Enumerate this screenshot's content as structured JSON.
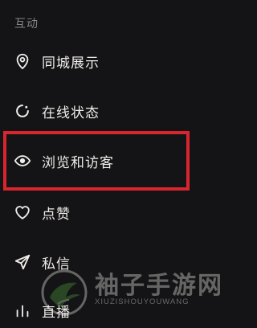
{
  "section": {
    "title": "互动"
  },
  "menu": {
    "items": [
      {
        "label": "同城展示",
        "icon": "location-pin-icon"
      },
      {
        "label": "在线状态",
        "icon": "online-status-icon"
      },
      {
        "label": "浏览和访客",
        "icon": "eye-icon"
      },
      {
        "label": "点赞",
        "icon": "heart-icon"
      },
      {
        "label": "私信",
        "icon": "send-icon"
      },
      {
        "label": "直播",
        "icon": "live-bars-icon"
      }
    ]
  },
  "highlight": {
    "color": "#d9262e",
    "target": "浏览和访客"
  },
  "watermark": {
    "title": "袖子手游网",
    "subtitle": "XIUZISHOUYOUWANG"
  },
  "colors": {
    "background": "#141416",
    "text": "#efece9",
    "section_title": "#86868a"
  }
}
